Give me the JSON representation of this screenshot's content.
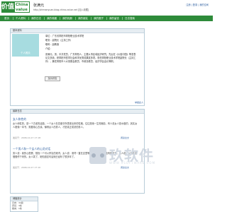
{
  "header": {
    "logo_left": "价值",
    "logo_right_top": "China",
    "logo_right_bottom": "value",
    "site_name": "张满元",
    "site_url": "http://zhmanyuan.blog.china-value.net [加入收藏]",
    "top_links": "注册 | 登录 | 我的空间"
  },
  "nav": {
    "items": [
      "首页",
      "个人资料",
      "我的日志",
      "我的收藏",
      "我的相册",
      "我的朋友",
      "我的圈子",
      "我的留言",
      "日志搜索"
    ]
  },
  "profile": {
    "section_title": "基本资料",
    "avatar_caption": "个人照片",
    "info_lines": [
      "单位：广东省揭阳市揭阳职业技术学院",
      "职务：副院长（主持工作）",
      "职称：副教授",
      "介绍："
    ],
    "description": "张满元，男，中共党员，广东揭阳人，主要从事区域经济研究。先后在《价值中国》等发表论文多篇，获揭阳市哲学社会科学优秀成果奖多项。现任揭阳职业技术学院副院长（主持工作），兼任揭阳市人大常委会委员、市政协委员、经济学会会长等职。",
    "add_friend": "加为好友",
    "report": "举报此人"
  },
  "articles": {
    "section_title": "最新日志",
    "items": [
      {
        "title": "女人和性的",
        "body": "女人和性的，是一个古老的话题。一个女人在恋爱中所表现出来的性格，往往是她一生的缩影。有人说女人是水做的，其实女人更像一本书，需要用心去读。懂得女人的男人，才是真正成熟的男人。",
        "meta": "发表于：2006-10-17 17:18",
        "readmore": "阅读全文"
      },
      {
        "title": "一个男人和一个女人的心灵对话",
        "body": "男人说：我的心很累，想找一个可以停靠的港湾。女人说：港湾一直在这里等你，只是你从来没有停下来。男人说：以后我会慢慢停下来的。女人笑了，她知道这句话她已经听了很多年了。",
        "meta": "发表于：2006-10-17 17:10",
        "readmore": "阅读全文"
      }
    ]
  },
  "stats": {
    "title": "博客统计",
    "lines": [
      "日志：34篇",
      "评论：3条",
      "留言：1条",
      "访问：1314"
    ]
  },
  "watermark": {
    "text": "玖软件",
    "sub": "WWW.9SOFTWARE.COM"
  },
  "colors": {
    "brand_green": "#2e8b3a",
    "link_blue": "#2e5fa0",
    "avatar_bg": "#a7dce0",
    "panel_head": "#e6edf2"
  }
}
